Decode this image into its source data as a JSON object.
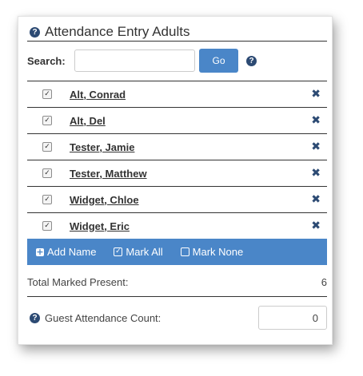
{
  "panel": {
    "title": "Attendance Entry Adults",
    "help_glyph": "?"
  },
  "search": {
    "label": "Search:",
    "value": "",
    "placeholder": "",
    "go_label": "Go"
  },
  "attendees": [
    {
      "name": "Alt, Conrad",
      "checked": true
    },
    {
      "name": "Alt, Del",
      "checked": true
    },
    {
      "name": "Tester, Jamie",
      "checked": true
    },
    {
      "name": "Tester, Matthew",
      "checked": true
    },
    {
      "name": "Widget, Chloe",
      "checked": true
    },
    {
      "name": "Widget, Eric",
      "checked": true
    }
  ],
  "actions": {
    "add_name": "Add Name",
    "mark_all": "Mark All",
    "mark_none": "Mark None"
  },
  "summary": {
    "total_label": "Total Marked Present:",
    "total_value": "6"
  },
  "guest": {
    "label": "Guest Attendance Count:",
    "value": "0"
  },
  "colors": {
    "accent": "#4a86c8",
    "icon_navy": "#2c4a73",
    "text": "#333333"
  },
  "icons": {
    "help": "question-circle-icon",
    "remove": "times-icon",
    "add": "plus-square-icon",
    "mark_all": "check-square-icon",
    "mark_none": "square-icon"
  }
}
